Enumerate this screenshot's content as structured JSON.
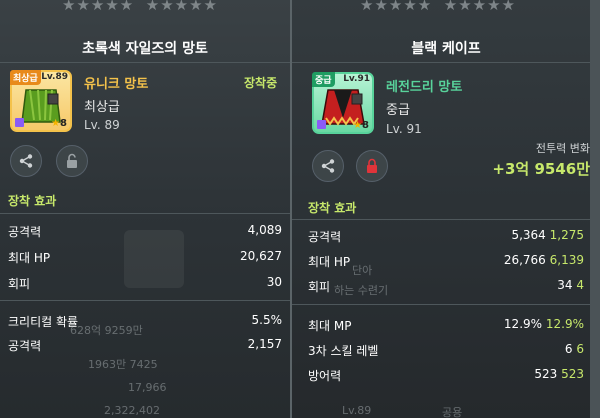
{
  "left": {
    "title": "초록색 자일즈의 망토",
    "item": {
      "grade_tag": "최상급",
      "level_tag": "Lv.89",
      "star_count": "8",
      "name": "유니크 망토",
      "grade": "최상급",
      "level": "Lv. 89",
      "status": "장착중",
      "icon": "green-cape"
    },
    "section": "장착 효과",
    "stats": [
      {
        "label": "공격력",
        "value": "4,089"
      },
      {
        "label": "최대 HP",
        "value": "20,627"
      },
      {
        "label": "회피",
        "value": "30"
      }
    ],
    "stats2": [
      {
        "label": "크리티컬 확률",
        "value": "5.5%"
      },
      {
        "label": "공격력",
        "value": "2,157"
      }
    ],
    "background_text": [
      "628억 9259만",
      "1963만 7425",
      "17,966",
      "2,322,402"
    ]
  },
  "right": {
    "title": "블랙 케이프",
    "item": {
      "grade_tag": "중급",
      "level_tag": "Lv.91",
      "star_count": "8",
      "name": "레전드리 망토",
      "grade": "중급",
      "level": "Lv. 91",
      "icon": "black-red-cape"
    },
    "cp_label": "전투력 변화",
    "cp_value": "+3억 9546만",
    "section": "장착 효과",
    "stats": [
      {
        "label": "공격력",
        "value": "5,364",
        "diff": "1,275"
      },
      {
        "label": "최대 HP",
        "value": "26,766",
        "diff": "6,139"
      },
      {
        "label": "회피",
        "value": "34",
        "diff": "4"
      }
    ],
    "stats2": [
      {
        "label": "최대 MP",
        "value": "12.9%",
        "diff": "12.9%"
      },
      {
        "label": "3차 스킬 레벨",
        "value": "6",
        "diff": "6"
      },
      {
        "label": "방어력",
        "value": "523",
        "diff": "523"
      }
    ],
    "background_text": [
      "단아",
      "하는 수련기",
      "Lv.89",
      "공용"
    ]
  },
  "colors": {
    "accent_green": "#c7e86b",
    "unique_orange": "#f4c24b",
    "legendary_green": "#58d39b",
    "stat_increase": "#c7e86b"
  }
}
